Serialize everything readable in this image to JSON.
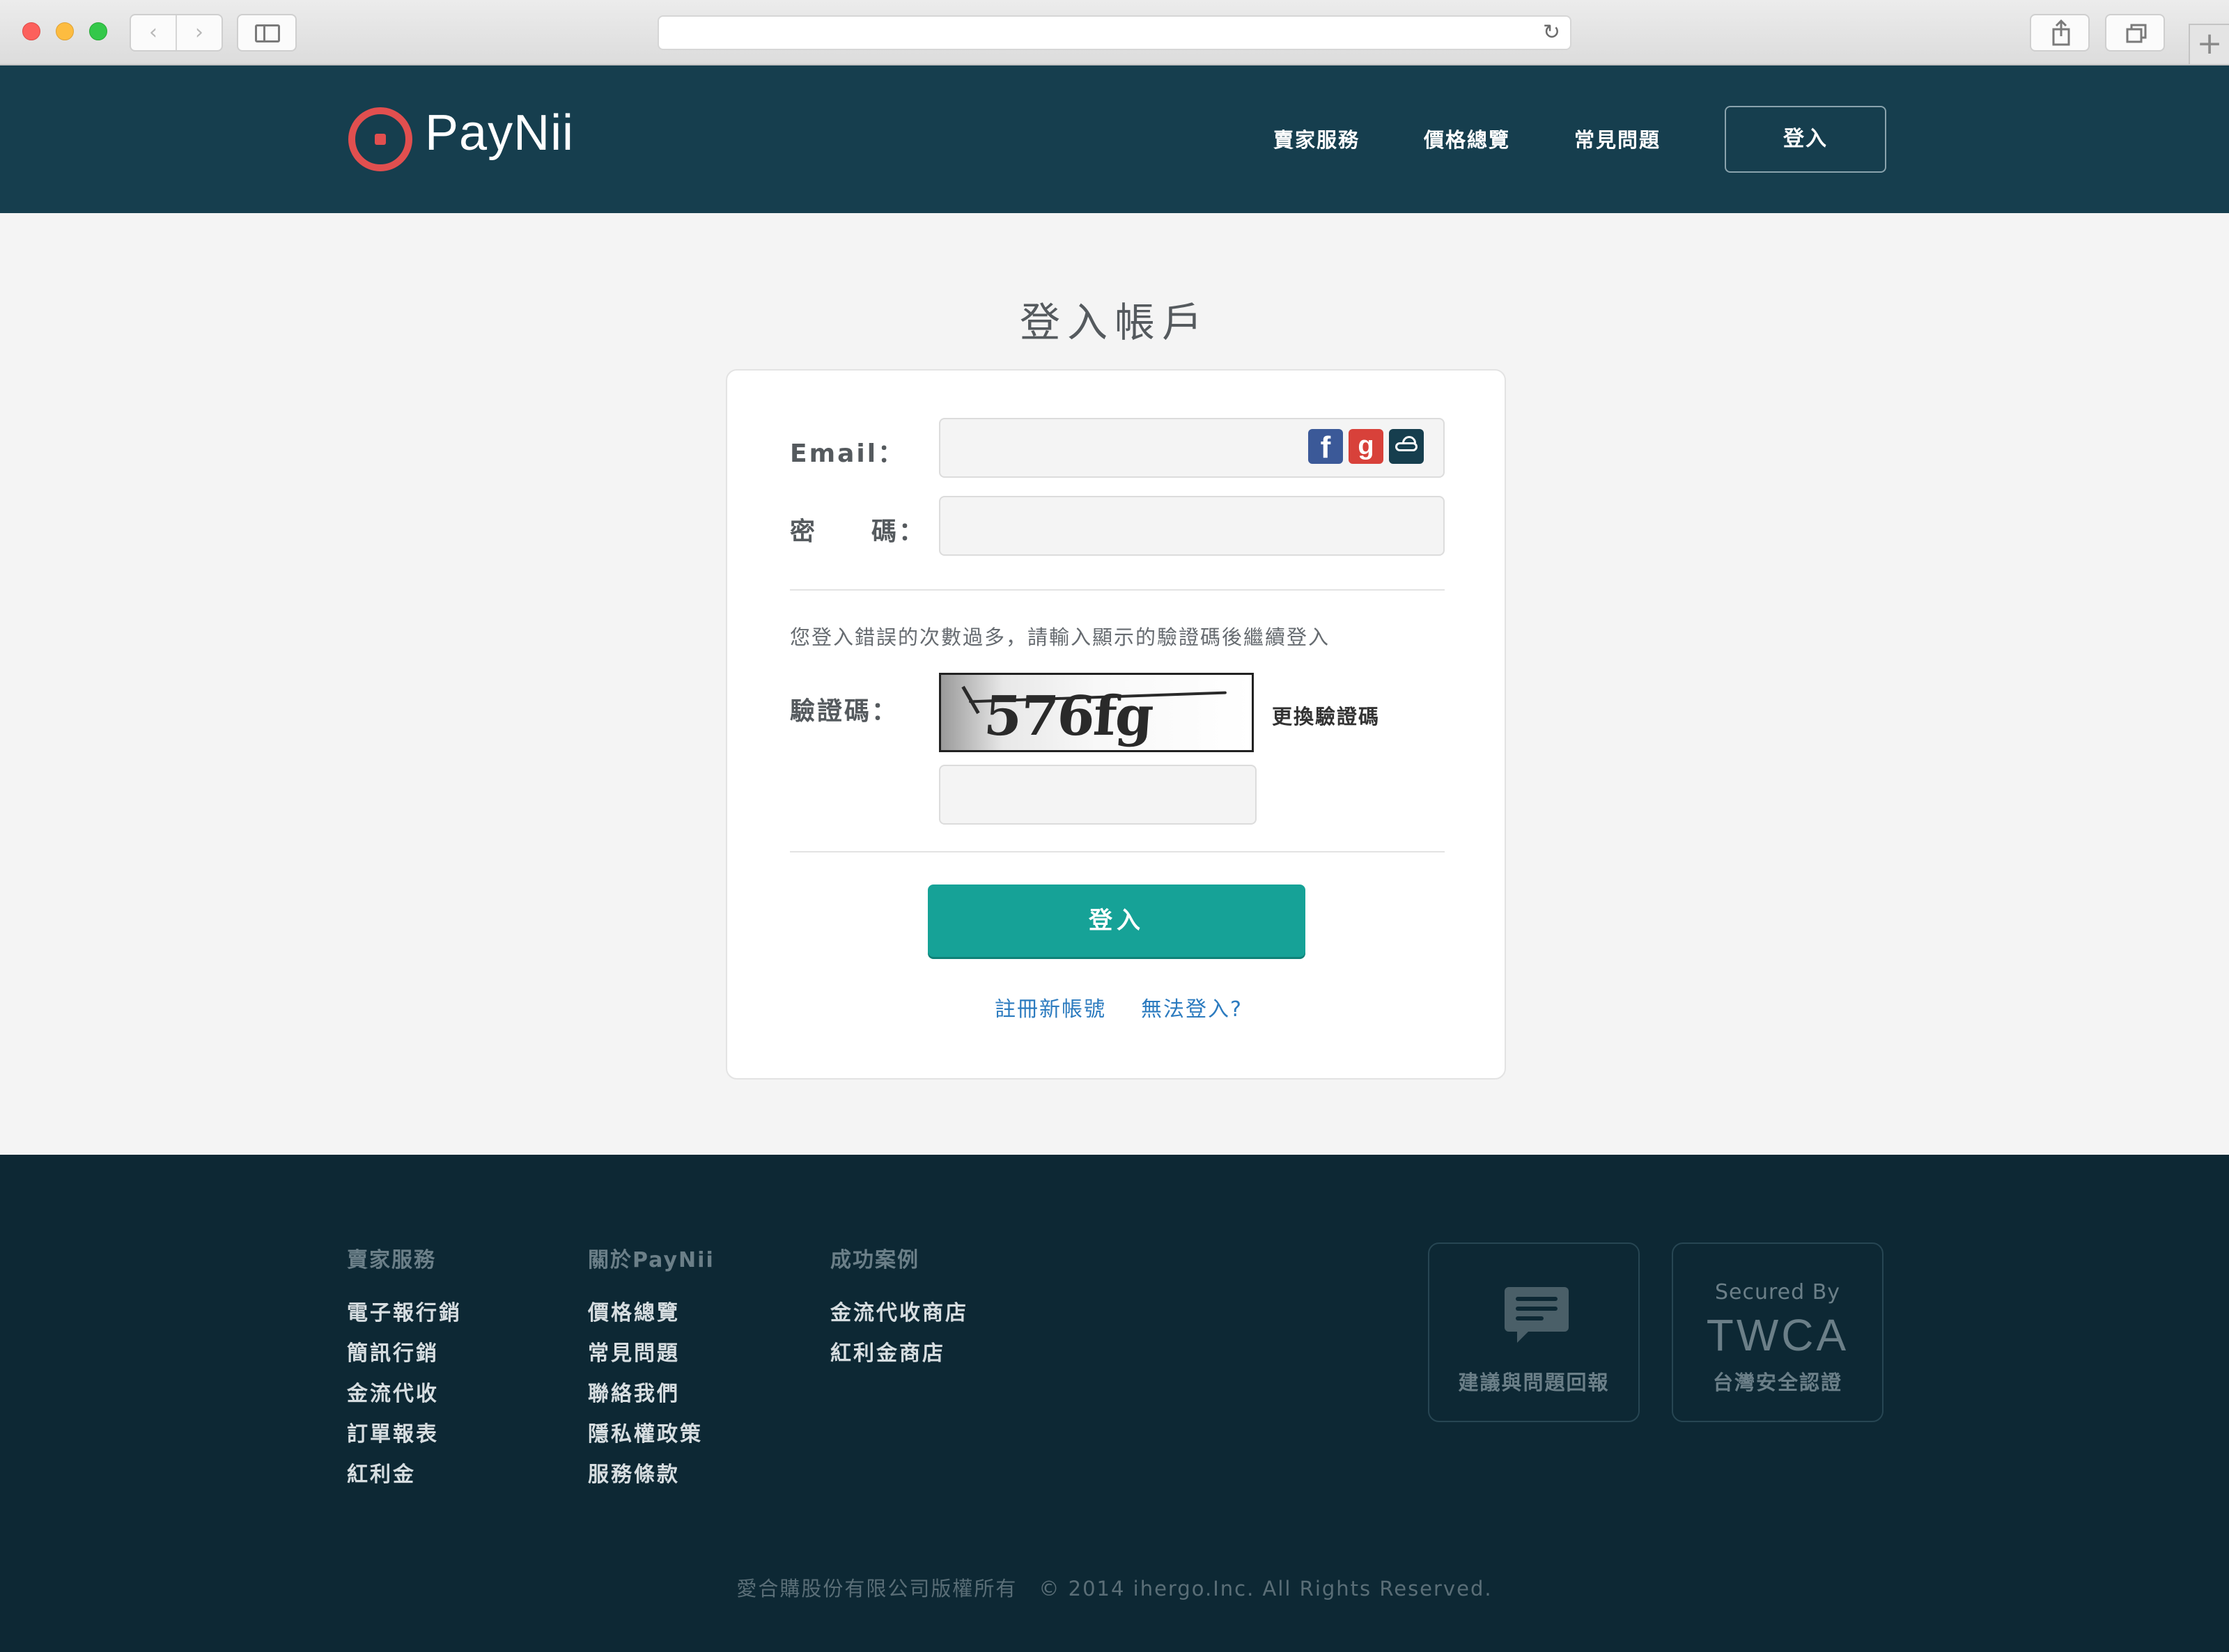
{
  "header": {
    "logo_text": "PayNii",
    "nav": [
      "賣家服務",
      "價格總覽",
      "常見問題"
    ],
    "login_button": "登入",
    "accent_color": "#163e4e",
    "logo_color": "#e14f4f"
  },
  "login": {
    "title": "登入帳戶",
    "email_label": "Email：",
    "password_label": "密　　碼：",
    "social_icons": [
      "facebook-icon",
      "google-plus-icon",
      "cloud-icon"
    ],
    "notice": "您登入錯誤的次數過多，請輸入顯示的驗證碼後繼續登入",
    "captcha_label": "驗證碼：",
    "captcha_text": "576fg",
    "refresh_captcha": "更換驗證碼",
    "submit": "登入",
    "submit_color": "#16a297",
    "register_link": "註冊新帳號",
    "cant_login_link": "無法登入?"
  },
  "footer": {
    "columns": [
      {
        "title": "賣家服務",
        "links": [
          "電子報行銷",
          "簡訊行銷",
          "金流代收",
          "訂單報表",
          "紅利金"
        ]
      },
      {
        "title": "關於PayNii",
        "links": [
          "價格總覽",
          "常見問題",
          "聯絡我們",
          "隱私權政策",
          "服務條款"
        ]
      },
      {
        "title": "成功案例",
        "links": [
          "金流代收商店",
          "紅利金商店"
        ]
      }
    ],
    "feedback_label": "建議與問題回報",
    "secured_by": "Secured By",
    "twca": "TWCA",
    "twca_label": "台灣安全認證",
    "copyright": "愛合購股份有限公司版權所有　© 2014 ihergo.Inc. All Rights Reserved."
  }
}
